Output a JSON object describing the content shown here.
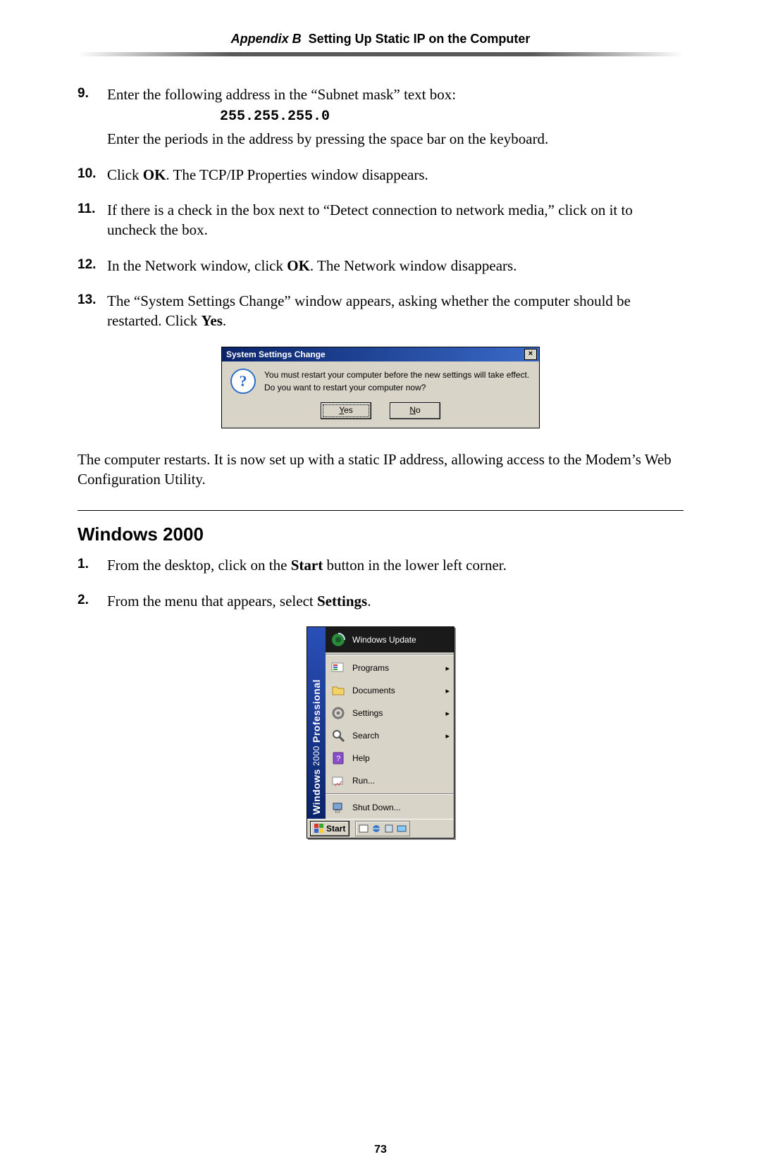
{
  "header": {
    "appendix": "Appendix B",
    "title": "Setting Up Static IP on the Computer"
  },
  "steps_a": {
    "s9": {
      "num": "9.",
      "line1": "Enter the following address in the “Subnet mask” text box:",
      "code": "255.255.255.0",
      "line2": "Enter the periods in the address by pressing the space bar on the keyboard."
    },
    "s10": {
      "num": "10.",
      "pre": "Click ",
      "ok": "OK",
      "post": ". The TCP/IP Properties window disappears."
    },
    "s11": {
      "num": "11.",
      "text": "If there is a check in the box next to “Detect connection to network media,” click on it to uncheck the box."
    },
    "s12": {
      "num": "12.",
      "pre": "In the Network window, click ",
      "ok": "OK",
      "post": ". The Network window disappears."
    },
    "s13": {
      "num": "13.",
      "pre": "The “System Settings Change” window appears, asking whether the computer should be restarted. Click ",
      "yes": "Yes",
      "post": "."
    }
  },
  "dialog": {
    "title": "System Settings Change",
    "line1": "You must restart your computer before the new settings will take effect.",
    "line2": "Do you want to restart your computer now?",
    "yes": "Yes",
    "no": "No",
    "close_glyph": "×",
    "q_glyph": "?"
  },
  "after_dialog": "The computer restarts. It is now set up with a static IP address, allowing access to the Modem’s Web Configuration Utility.",
  "section_heading": "Windows 2000",
  "steps_b": {
    "s1": {
      "num": "1.",
      "pre": "From the desktop, click on the ",
      "bold": "Start",
      "post": " button in the lower left corner."
    },
    "s2": {
      "num": "2.",
      "pre": "From the menu that appears, select ",
      "bold": "Settings",
      "post": "."
    }
  },
  "start_menu": {
    "banner_bold": "Windows",
    "banner_thin": "2000",
    "banner_tail": "Professional",
    "items": {
      "update": {
        "label": "Windows Update",
        "arrow": false
      },
      "programs": {
        "label": "Programs",
        "arrow": true
      },
      "documents": {
        "label": "Documents",
        "arrow": true
      },
      "settings": {
        "label": "Settings",
        "arrow": true
      },
      "search": {
        "label": "Search",
        "arrow": true
      },
      "help": {
        "label": "Help",
        "arrow": false
      },
      "run": {
        "label": "Run...",
        "arrow": false
      },
      "shutdown": {
        "label": "Shut Down...",
        "arrow": false
      }
    },
    "start_label": "Start"
  },
  "page_number": "73"
}
